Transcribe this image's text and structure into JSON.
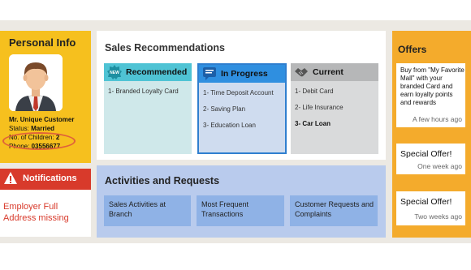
{
  "personal": {
    "title": "Personal Info",
    "name": "Mr. Unique Customer",
    "status_label": "Status:",
    "status_value": "Married",
    "children_label": "No. of Children:",
    "children_value": "2",
    "phone_label": "Phone:",
    "phone_value": "03556677"
  },
  "notifications": {
    "title": "Notifications",
    "message": "Employer Full Address missing"
  },
  "sales": {
    "title": "Sales Recommendations",
    "columns": [
      {
        "label": "Recommended",
        "items": [
          "1- Branded Loyalty Card"
        ]
      },
      {
        "label": "In Progress",
        "items": [
          "1- Time Deposit Account",
          "2- Saving Plan",
          "3- Education Loan"
        ]
      },
      {
        "label": "Current",
        "items": [
          "1- Debit Card",
          "2- Life Insurance",
          "3- Car Loan"
        ]
      }
    ]
  },
  "activities": {
    "title": "Activities and Requests",
    "items": [
      "Sales Activities at Branch",
      "Most Frequent Transactions",
      "Customer Requests and Complaints"
    ]
  },
  "offers": {
    "title": "Offers",
    "cards": [
      {
        "text": "Buy from \"My Favorite Mall\" with your branded Card and earn loyalty points and rewards",
        "time": "A few hours ago"
      },
      {
        "text": "Special Offer!",
        "time": "One week ago"
      },
      {
        "text": "Special Offer!",
        "time": "Two weeks ago"
      }
    ]
  },
  "colors": {
    "personal_bg": "#f6c01e",
    "notif_red": "#d83a2b",
    "recommended": "#4fc3d4",
    "in_progress": "#2f8fe0",
    "current": "#b6b7b8",
    "activities_bg": "#b9cbed",
    "offers_bg": "#f4ab2c"
  },
  "icons": {
    "recommended": "new-badge-icon",
    "in_progress": "chat-bubble-icon",
    "current": "handshake-icon",
    "notifications": "warning-icon"
  }
}
